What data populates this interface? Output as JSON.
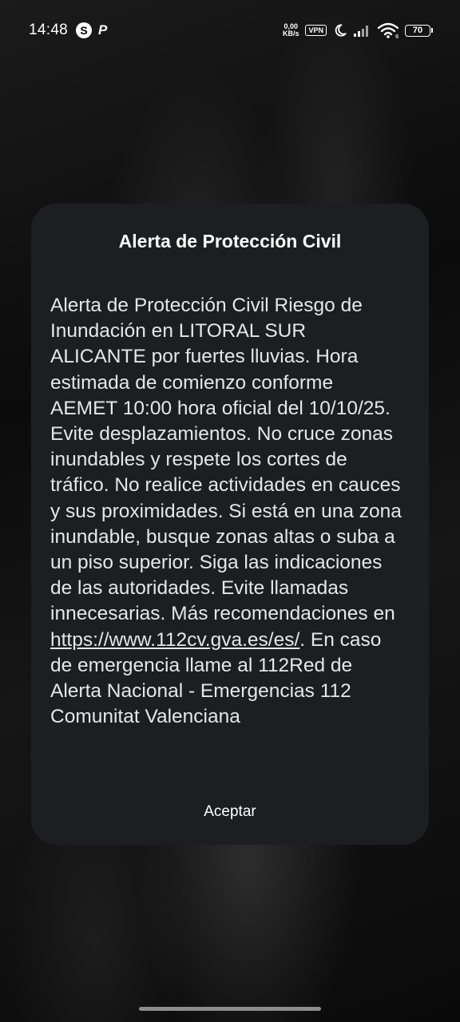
{
  "status_bar": {
    "time": "14:48",
    "net_speed_value": "0,00",
    "net_speed_unit": "KB/s",
    "vpn_label": "VPN",
    "signal_label": "6",
    "battery_level": "70"
  },
  "dialog": {
    "title": "Alerta de Protección Civil",
    "body_before_link": "Alerta de Protección Civil Riesgo de Inundación en LITORAL SUR ALICANTE por fuertes lluvias. Hora estimada de comienzo conforme AEMET 10:00 hora oficial del 10/10/25. Evite desplazamientos. No cruce zonas inundables y respete los cortes de tráfico. No realice actividades en cauces y sus proximidades. Si está en una zona inundable, busque zonas altas o suba a un piso superior. Siga las indicaciones de las autoridades. Evite llamadas innecesarias. Más recomendaciones en ",
    "link_text": "https://www.112cv.gva.es/es/",
    "body_after_link": ". En caso de emergencia llame al 112Red de Alerta Nacional - Emergencias 112 Comunitat Valenciana",
    "accept_label": "Aceptar"
  }
}
